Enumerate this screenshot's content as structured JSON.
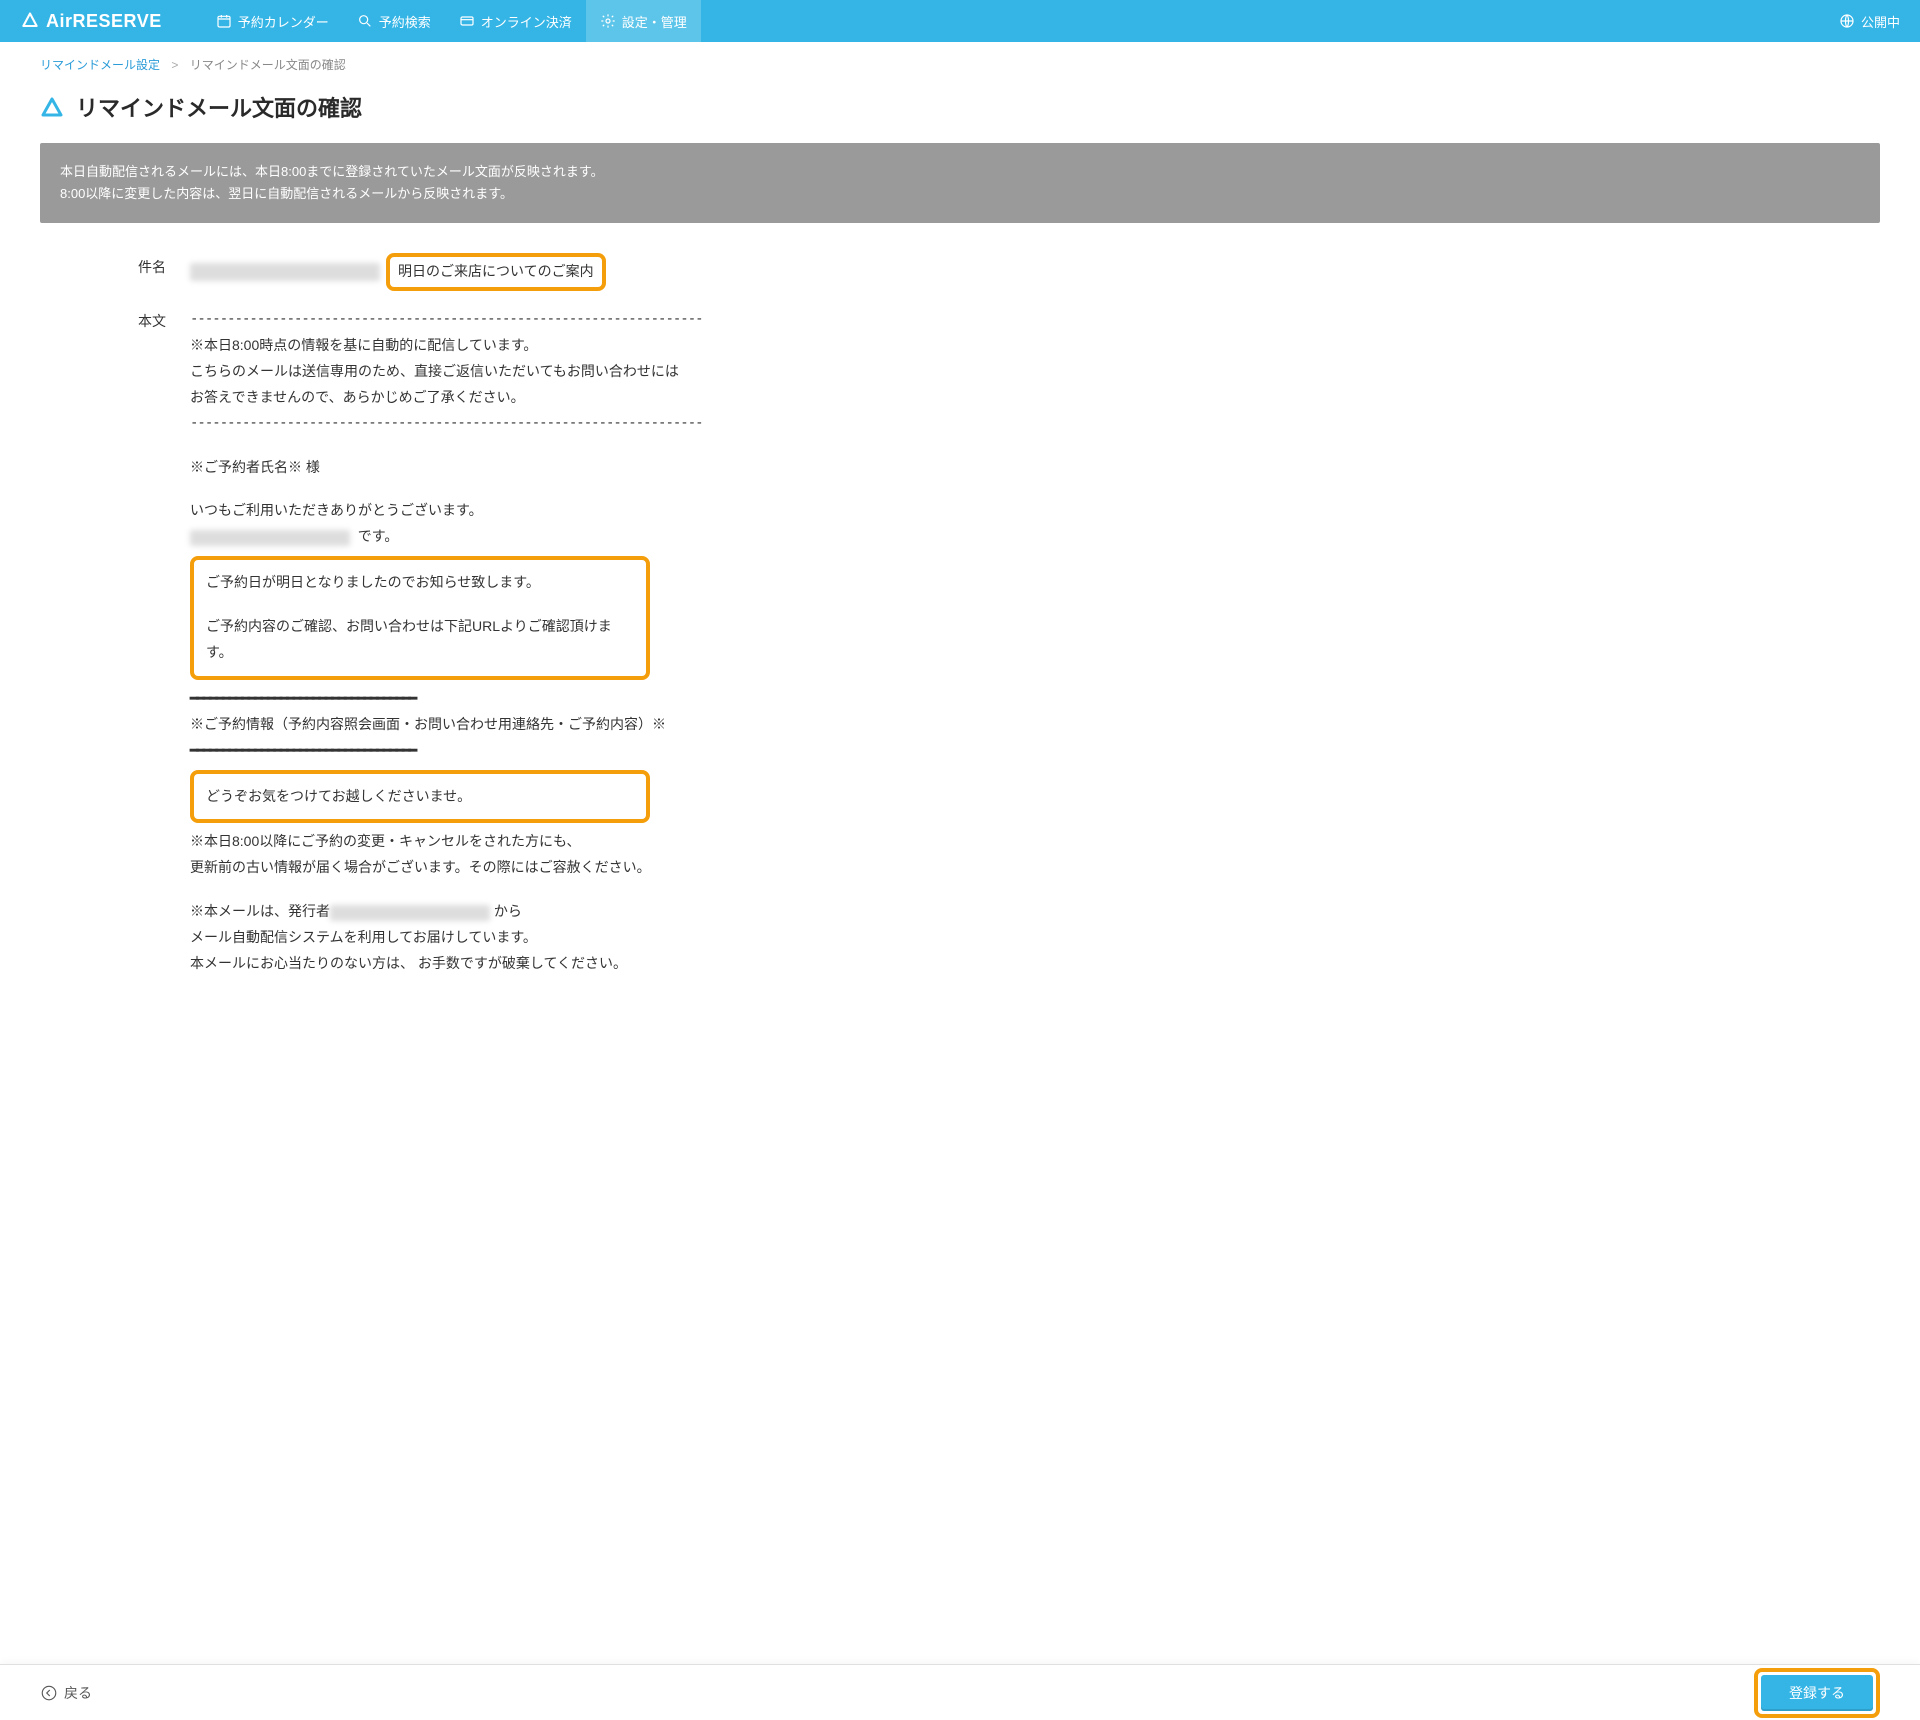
{
  "header": {
    "logo_text": "AirRESERVE",
    "nav": [
      {
        "label": "予約カレンダー",
        "icon": "calendar"
      },
      {
        "label": "予約検索",
        "icon": "search"
      },
      {
        "label": "オンライン決済",
        "icon": "card"
      },
      {
        "label": "設定・管理",
        "icon": "gear",
        "active": true
      }
    ],
    "status_label": "公開中"
  },
  "breadcrumb": {
    "parent": "リマインドメール設定",
    "current": "リマインドメール文面の確認"
  },
  "page_title": "リマインドメール文面の確認",
  "notice": {
    "line1": "本日自動配信されるメールには、本日8:00までに登録されていたメール文面が反映されます。",
    "line2": "8:00以降に変更した内容は、翌日に自動配信されるメールから反映されます。"
  },
  "fields": {
    "subject_label": "件名",
    "subject_highlight": "明日のご来店についてのご案内",
    "body_label": "本文",
    "body": {
      "dash_line": "---------------------------------------------------------------------",
      "l1": "※本日8:00時点の情報を基に自動的に配信しています。",
      "l2": "こちらのメールは送信専用のため、直接ご返信いただいてもお問い合わせには",
      "l3": "お答えできませんので、あらかじめご了承ください。",
      "l4": "※ご予約者氏名※ 様",
      "l5": "いつもご利用いただきありがとうございます。",
      "l6_suffix": "です。",
      "hl1_a": "ご予約日が明日となりましたのでお知らせ致します。",
      "hl1_b": "ご予約内容のご確認、お問い合わせは下記URLよりご確認頂けます。",
      "heavy": "━━━━━━━━━━━━━━━━━━━━━━━━━━━━━━━━━━━",
      "l7": "※ご予約情報（予約内容照会画面・お問い合わせ用連絡先・ご予約内容）※",
      "hl2": "どうぞお気をつけてお越しくださいませ。",
      "l8": "※本日8:00以降にご予約の変更・キャンセルをされた方にも、",
      "l9": "更新前の古い情報が届く場合がございます。その際にはご容赦ください。",
      "l10_prefix": "※本メールは、発行者",
      "l10_suffix": "から",
      "l11": "メール自動配信システムを利用してお届けしています。",
      "l12": "本メールにお心当たりのない方は、 お手数ですが破棄してください。"
    }
  },
  "footer": {
    "back_label": "戻る",
    "submit_label": "登録する"
  }
}
